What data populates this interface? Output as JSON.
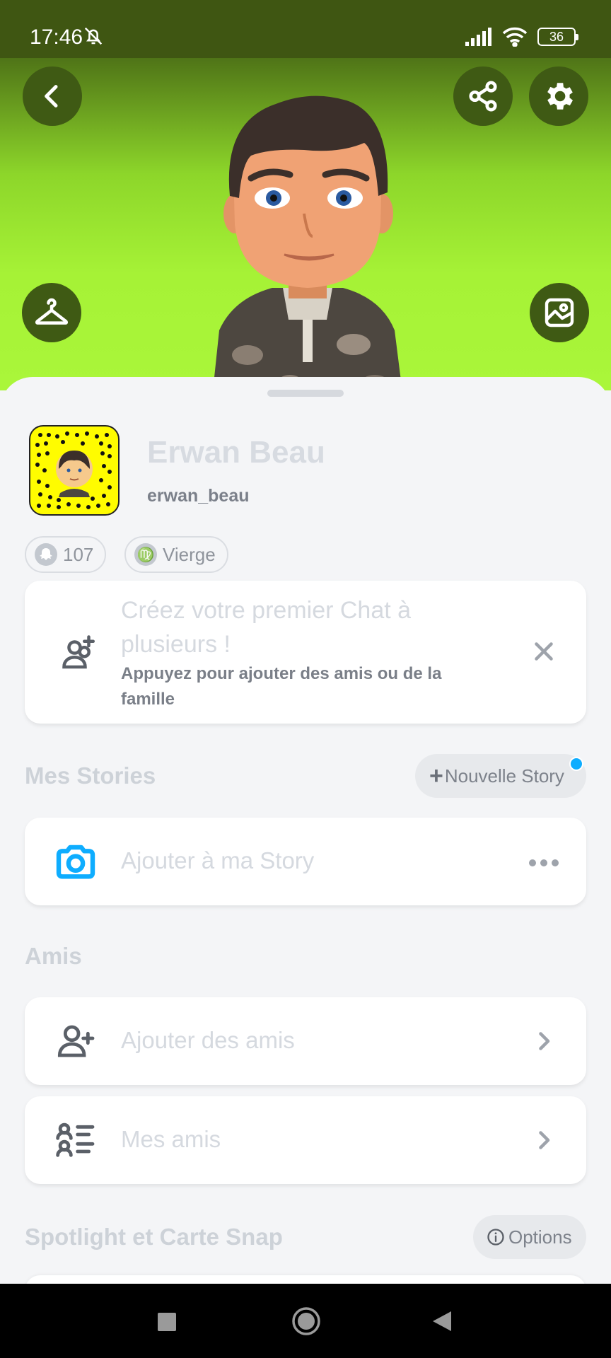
{
  "status_bar": {
    "time": "17:46",
    "battery": "36",
    "icons": [
      "bell-muted-icon",
      "signal-icon",
      "wifi-icon",
      "battery-icon"
    ]
  },
  "header": {
    "buttons": [
      "back-icon",
      "share-icon",
      "settings-icon",
      "hanger-icon",
      "gallery-icon"
    ],
    "background_color": "#a6f236"
  },
  "profile": {
    "display_name": "Erwan Beau",
    "username": "erwan_beau",
    "snap_score": "107",
    "zodiac": "Vierge",
    "zodiac_symbol": "♍"
  },
  "group_chat_card": {
    "title": "Créez votre premier Chat à plusieurs !",
    "subtitle": "Appuyez pour ajouter des amis ou de la famille"
  },
  "stories": {
    "section_title": "Mes Stories",
    "new_story_button": "Nouvelle Story",
    "add_story_label": "Ajouter à ma Story"
  },
  "friends": {
    "section_title": "Amis",
    "add_friends_label": "Ajouter des amis",
    "my_friends_label": "Mes amis"
  },
  "spotlight": {
    "section_title": "Spotlight et Carte Snap",
    "options_button": "Options"
  },
  "colors": {
    "accent_blue": "#0eadff",
    "snapcode_yellow": "#fffc00",
    "status_bar": "#3f5612"
  }
}
